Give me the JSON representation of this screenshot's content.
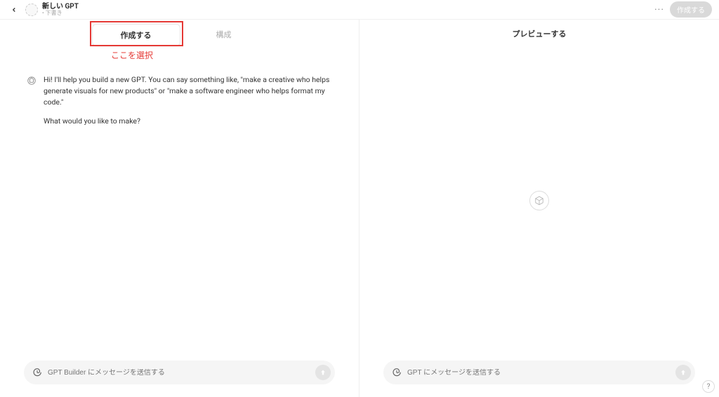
{
  "header": {
    "title": "新しい GPT",
    "subtitle": "• 下書き",
    "create_button": "作成する"
  },
  "tabs": {
    "create": "作成する",
    "configure": "構成"
  },
  "annotation": {
    "label": "ここを選択"
  },
  "chat": {
    "message_line1": "Hi! I'll help you build a new GPT. You can say something like, \"make a creative who helps generate visuals for new products\" or \"make a software engineer who helps format my code.\"",
    "message_line2": "What would you like to make?"
  },
  "preview": {
    "title": "プレビューする"
  },
  "inputs": {
    "left_placeholder": "GPT Builder にメッセージを送信する",
    "right_placeholder": "GPT にメッセージを送信する"
  },
  "help": "?"
}
